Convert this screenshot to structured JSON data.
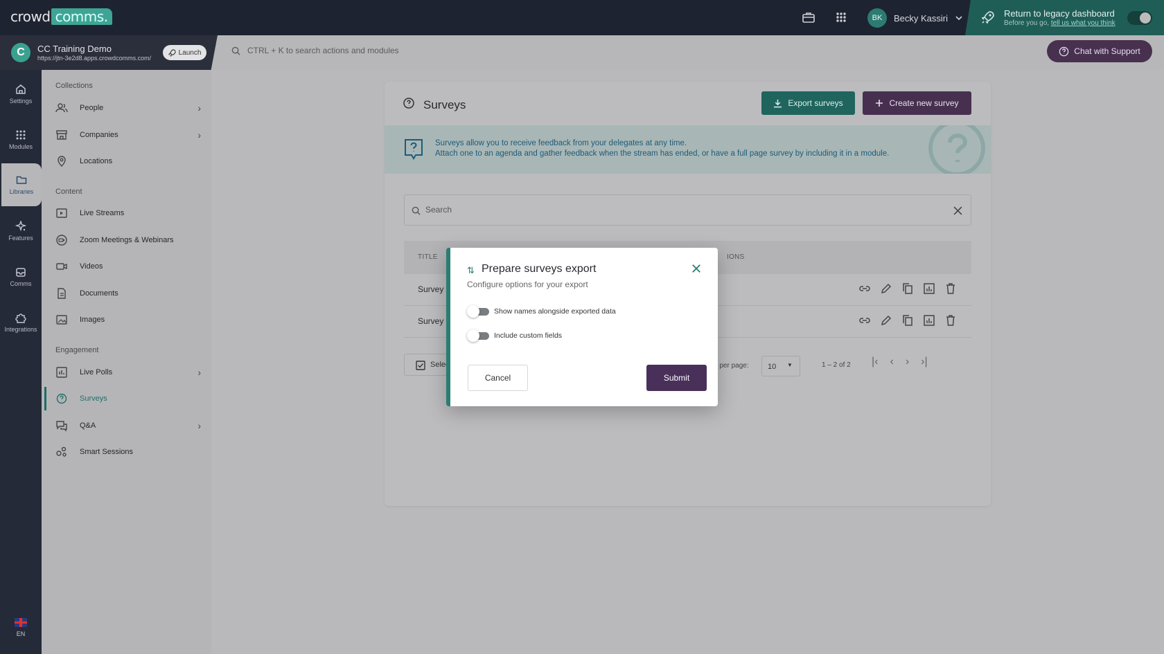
{
  "topbar": {
    "logo_left": "crowd",
    "logo_right": "comms.",
    "user_initials": "BK",
    "user_name": "Becky Kassiri",
    "legacy_title": "Return to legacy dashboard",
    "legacy_sub_prefix": "Before you go, ",
    "legacy_sub_link": "tell us what you think"
  },
  "event": {
    "logo_letter": "C",
    "name": "CC Training Demo",
    "url": "https://jtn-3e2d8.apps.crowdcomms.com/",
    "launch_label": "Launch"
  },
  "search_bar": {
    "placeholder": "CTRL + K to search actions and modules"
  },
  "chat_label": "Chat with Support",
  "rail": {
    "items": [
      {
        "label": "Settings",
        "icon": "home-icon"
      },
      {
        "label": "Modules",
        "icon": "grid-icon"
      },
      {
        "label": "Libraries",
        "icon": "folder-icon"
      },
      {
        "label": "Features",
        "icon": "sparkle-icon"
      },
      {
        "label": "Comms",
        "icon": "inbox-icon"
      },
      {
        "label": "Integrations",
        "icon": "puzzle-icon"
      }
    ],
    "language": "EN"
  },
  "sidebar": {
    "sections": [
      "Collections",
      "Content",
      "Engagement"
    ],
    "items": [
      {
        "label": "People"
      },
      {
        "label": "Companies"
      },
      {
        "label": "Locations"
      },
      {
        "label": "Live Streams"
      },
      {
        "label": "Zoom Meetings & Webinars"
      },
      {
        "label": "Videos"
      },
      {
        "label": "Documents"
      },
      {
        "label": "Images"
      },
      {
        "label": "Live Polls"
      },
      {
        "label": "Surveys"
      },
      {
        "label": "Q&A"
      },
      {
        "label": "Smart Sessions"
      }
    ]
  },
  "main": {
    "title": "Surveys",
    "export_label": "Export surveys",
    "create_label": "Create new survey",
    "info_line1": "Surveys allow you to receive feedback from your delegates at any time.",
    "info_line2": "Attach one to an agenda and gather feedback when the stream has ended, or have a full page survey by including it in a module.",
    "search_placeholder": "Search",
    "col_title": "TITLE",
    "col_actions": "IONS",
    "rows": [
      {
        "title": "Survey"
      },
      {
        "title": "Survey"
      }
    ],
    "select_label": "Selec",
    "per_page_label": "ns per page:",
    "per_page_value": "10",
    "range": "1 – 2 of 2"
  },
  "modal": {
    "title": "Prepare surveys export",
    "subtitle": "Configure options for your export",
    "toggle1": "Show names alongside exported data",
    "toggle2": "Include custom fields",
    "cancel": "Cancel",
    "submit": "Submit"
  }
}
